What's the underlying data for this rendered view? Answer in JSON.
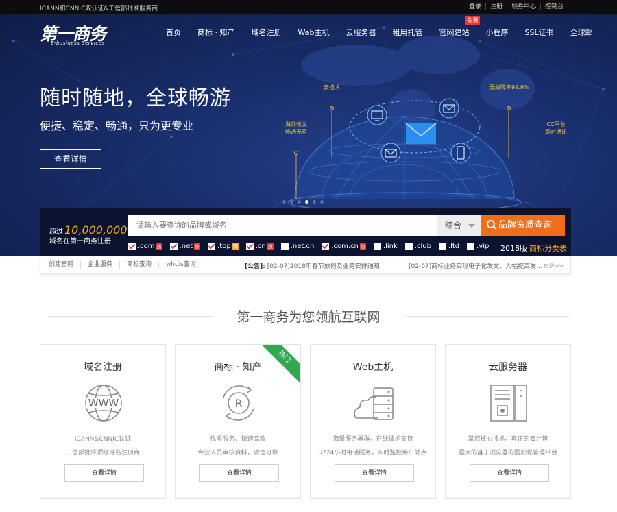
{
  "topbar": {
    "notice": "ICANN和CNNIC双认证&工信部批准服务商",
    "links": [
      "登录",
      "注册",
      "领券中心",
      "控制台"
    ]
  },
  "logo": {
    "mark": "第一商务",
    "sub": "E-business Services"
  },
  "nav": {
    "items": [
      "首页",
      "商标 · 知产",
      "域名注册",
      "Web主机",
      "云服务器",
      "租用托管",
      "官网建站",
      "小程序",
      "SSL证书",
      "全球邮"
    ],
    "badge": "免费"
  },
  "hero": {
    "slogan": "随时随地，全球畅游",
    "subslogan": "便捷、稳定、畅通，只为更专业",
    "button": "查看详情",
    "labels": {
      "cloud": "云技术",
      "uptime": "无故障率99.9%",
      "overseas1": "海外收发",
      "overseas2": "畅通无阻",
      "cc1": "CC平台",
      "cc2": "即时通讯"
    }
  },
  "search": {
    "count_prefix": "超过",
    "count_value": "10,000,000",
    "count_suffix": "域名在第一商务注册",
    "placeholder": "请输入要查询的品牌或域名",
    "select": "综合",
    "button": "品牌资质查询",
    "tlds": [
      {
        "name": ".com",
        "checked": true,
        "tag": "热"
      },
      {
        "name": ".net",
        "checked": true,
        "tag": "热"
      },
      {
        "name": ".top",
        "checked": true,
        "tag": "荐"
      },
      {
        "name": ".cn",
        "checked": true,
        "tag": "热"
      },
      {
        "name": ".net.cn",
        "checked": false,
        "tag": ""
      },
      {
        "name": ".com.cn",
        "checked": true,
        "tag": "热"
      },
      {
        "name": ".link",
        "checked": false,
        "tag": ""
      },
      {
        "name": ".club",
        "checked": false,
        "tag": ""
      },
      {
        "name": ".ltd",
        "checked": false,
        "tag": ""
      },
      {
        "name": ".vip",
        "checked": false,
        "tag": ""
      }
    ],
    "version": "2018版",
    "class_link": "商标分类表"
  },
  "news": {
    "links": [
      "创建官网",
      "企业服务",
      "商标查询",
      "whois查询"
    ],
    "ann_label": "[公告]:",
    "ann1": "[02-07]2018年春节放假及业务安排通知",
    "ann2": "[02-07]商标业务实现电子化发文，大幅提高发...",
    "more": "更多>>"
  },
  "section": {
    "title": "第一商务为您领航互联网",
    "cards": [
      {
        "title": "域名注册",
        "d1": "ICANN&CNNIC认证",
        "d2": "工信部批准顶级域名注册商",
        "button": "查看详情"
      },
      {
        "title": "商标 · 知产",
        "d1": "优质服务、快速高效",
        "d2": "专业人员审核资料，诚信可靠",
        "button": "查看详情",
        "ribbon": "热门"
      },
      {
        "title": "Web主机",
        "d1": "海量服务器群，在线技术支持",
        "d2": "7*24小时电话服务，实时监控用户站点",
        "button": "查看详情"
      },
      {
        "title": "云服务器",
        "d1": "掌控核心技术，真正的云计算",
        "d2": "强大的基于浏览器的图形化管理平台",
        "button": "查看详情"
      }
    ]
  },
  "colors": {
    "hero_bg": "#1a2f6e",
    "accent_orange": "#f06d1a",
    "label_yellow": "#f0c23c",
    "hot_red": "#e53935",
    "ribbon_green": "#2fa84f"
  }
}
